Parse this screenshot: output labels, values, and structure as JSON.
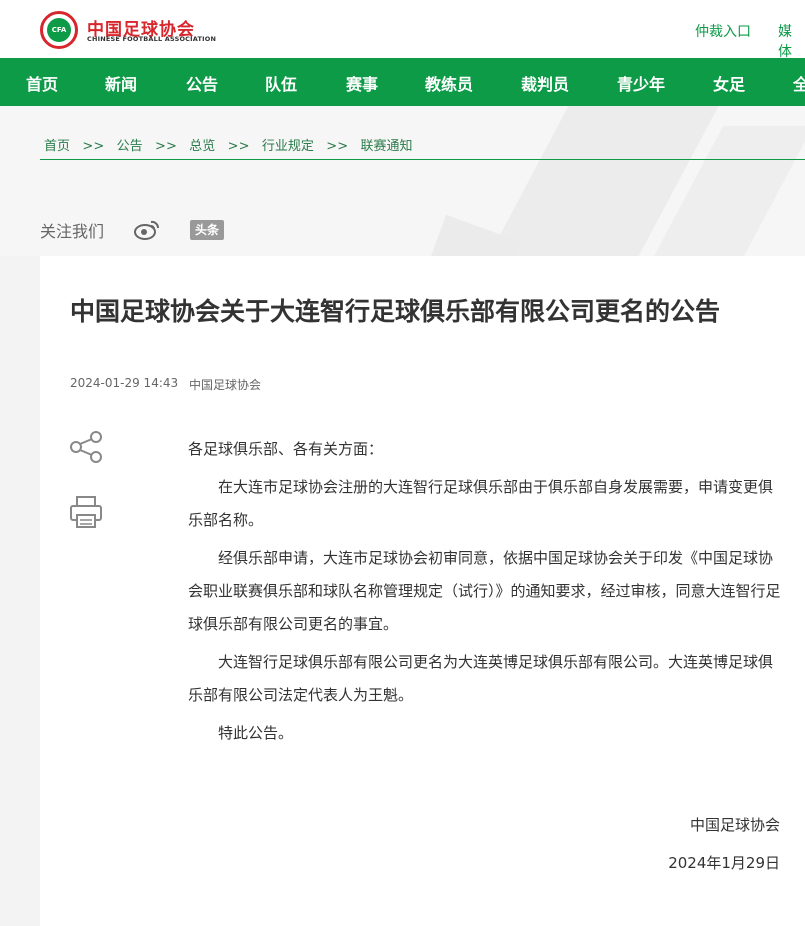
{
  "header": {
    "logo_badge": "CFA",
    "logo_title": "中国足球协会",
    "logo_subtitle": "CHINESE FOOTBALL ASSOCIATION",
    "links": [
      "仲裁入口",
      "媒体"
    ]
  },
  "nav": {
    "items": [
      "首页",
      "新闻",
      "公告",
      "队伍",
      "赛事",
      "教练员",
      "裁判员",
      "青少年",
      "女足",
      "全"
    ]
  },
  "breadcrumb": {
    "items": [
      "首页",
      "公告",
      "总览",
      "行业规定",
      "联赛通知"
    ],
    "separator": ">>"
  },
  "follow": {
    "label": "关注我们",
    "toutiao_label": "头条"
  },
  "article": {
    "title": "中国足球协会关于大连智行足球俱乐部有限公司更名的公告",
    "date": "2024-01-29 14:43",
    "source": "中国足球协会",
    "salutation": "各足球俱乐部、各有关方面：",
    "paragraphs": [
      "在大连市足球协会注册的大连智行足球俱乐部由于俱乐部自身发展需要，申请变更俱乐部名称。",
      "经俱乐部申请，大连市足球协会初审同意，依据中国足球协会关于印发《中国足球协会职业联赛俱乐部和球队名称管理规定（试行）》的通知要求，经过审核，同意大连智行足球俱乐部有限公司更名的事宜。",
      "大连智行足球俱乐部有限公司更名为大连英博足球俱乐部有限公司。大连英博足球俱乐部有限公司法定代表人为王魁。",
      "特此公告。"
    ],
    "signature": "中国足球协会",
    "sign_date": "2024年1月29日"
  },
  "colors": {
    "brand_green": "#0d9b48",
    "brand_red": "#d7262c"
  }
}
